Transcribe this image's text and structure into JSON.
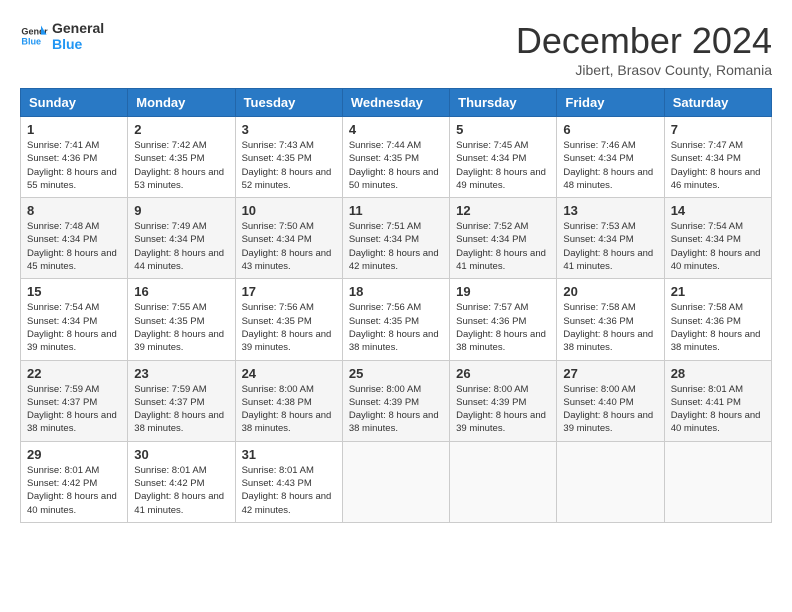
{
  "header": {
    "logo_line1": "General",
    "logo_line2": "Blue",
    "month": "December 2024",
    "location": "Jibert, Brasov County, Romania"
  },
  "weekdays": [
    "Sunday",
    "Monday",
    "Tuesday",
    "Wednesday",
    "Thursday",
    "Friday",
    "Saturday"
  ],
  "weeks": [
    [
      {
        "day": "1",
        "sunrise": "7:41 AM",
        "sunset": "4:36 PM",
        "daylight": "8 hours and 55 minutes."
      },
      {
        "day": "2",
        "sunrise": "7:42 AM",
        "sunset": "4:35 PM",
        "daylight": "8 hours and 53 minutes."
      },
      {
        "day": "3",
        "sunrise": "7:43 AM",
        "sunset": "4:35 PM",
        "daylight": "8 hours and 52 minutes."
      },
      {
        "day": "4",
        "sunrise": "7:44 AM",
        "sunset": "4:35 PM",
        "daylight": "8 hours and 50 minutes."
      },
      {
        "day": "5",
        "sunrise": "7:45 AM",
        "sunset": "4:34 PM",
        "daylight": "8 hours and 49 minutes."
      },
      {
        "day": "6",
        "sunrise": "7:46 AM",
        "sunset": "4:34 PM",
        "daylight": "8 hours and 48 minutes."
      },
      {
        "day": "7",
        "sunrise": "7:47 AM",
        "sunset": "4:34 PM",
        "daylight": "8 hours and 46 minutes."
      }
    ],
    [
      {
        "day": "8",
        "sunrise": "7:48 AM",
        "sunset": "4:34 PM",
        "daylight": "8 hours and 45 minutes."
      },
      {
        "day": "9",
        "sunrise": "7:49 AM",
        "sunset": "4:34 PM",
        "daylight": "8 hours and 44 minutes."
      },
      {
        "day": "10",
        "sunrise": "7:50 AM",
        "sunset": "4:34 PM",
        "daylight": "8 hours and 43 minutes."
      },
      {
        "day": "11",
        "sunrise": "7:51 AM",
        "sunset": "4:34 PM",
        "daylight": "8 hours and 42 minutes."
      },
      {
        "day": "12",
        "sunrise": "7:52 AM",
        "sunset": "4:34 PM",
        "daylight": "8 hours and 41 minutes."
      },
      {
        "day": "13",
        "sunrise": "7:53 AM",
        "sunset": "4:34 PM",
        "daylight": "8 hours and 41 minutes."
      },
      {
        "day": "14",
        "sunrise": "7:54 AM",
        "sunset": "4:34 PM",
        "daylight": "8 hours and 40 minutes."
      }
    ],
    [
      {
        "day": "15",
        "sunrise": "7:54 AM",
        "sunset": "4:34 PM",
        "daylight": "8 hours and 39 minutes."
      },
      {
        "day": "16",
        "sunrise": "7:55 AM",
        "sunset": "4:35 PM",
        "daylight": "8 hours and 39 minutes."
      },
      {
        "day": "17",
        "sunrise": "7:56 AM",
        "sunset": "4:35 PM",
        "daylight": "8 hours and 39 minutes."
      },
      {
        "day": "18",
        "sunrise": "7:56 AM",
        "sunset": "4:35 PM",
        "daylight": "8 hours and 38 minutes."
      },
      {
        "day": "19",
        "sunrise": "7:57 AM",
        "sunset": "4:36 PM",
        "daylight": "8 hours and 38 minutes."
      },
      {
        "day": "20",
        "sunrise": "7:58 AM",
        "sunset": "4:36 PM",
        "daylight": "8 hours and 38 minutes."
      },
      {
        "day": "21",
        "sunrise": "7:58 AM",
        "sunset": "4:36 PM",
        "daylight": "8 hours and 38 minutes."
      }
    ],
    [
      {
        "day": "22",
        "sunrise": "7:59 AM",
        "sunset": "4:37 PM",
        "daylight": "8 hours and 38 minutes."
      },
      {
        "day": "23",
        "sunrise": "7:59 AM",
        "sunset": "4:37 PM",
        "daylight": "8 hours and 38 minutes."
      },
      {
        "day": "24",
        "sunrise": "8:00 AM",
        "sunset": "4:38 PM",
        "daylight": "8 hours and 38 minutes."
      },
      {
        "day": "25",
        "sunrise": "8:00 AM",
        "sunset": "4:39 PM",
        "daylight": "8 hours and 38 minutes."
      },
      {
        "day": "26",
        "sunrise": "8:00 AM",
        "sunset": "4:39 PM",
        "daylight": "8 hours and 39 minutes."
      },
      {
        "day": "27",
        "sunrise": "8:00 AM",
        "sunset": "4:40 PM",
        "daylight": "8 hours and 39 minutes."
      },
      {
        "day": "28",
        "sunrise": "8:01 AM",
        "sunset": "4:41 PM",
        "daylight": "8 hours and 40 minutes."
      }
    ],
    [
      {
        "day": "29",
        "sunrise": "8:01 AM",
        "sunset": "4:42 PM",
        "daylight": "8 hours and 40 minutes."
      },
      {
        "day": "30",
        "sunrise": "8:01 AM",
        "sunset": "4:42 PM",
        "daylight": "8 hours and 41 minutes."
      },
      {
        "day": "31",
        "sunrise": "8:01 AM",
        "sunset": "4:43 PM",
        "daylight": "8 hours and 42 minutes."
      },
      null,
      null,
      null,
      null
    ]
  ],
  "labels": {
    "sunrise": "Sunrise:",
    "sunset": "Sunset:",
    "daylight": "Daylight:"
  }
}
